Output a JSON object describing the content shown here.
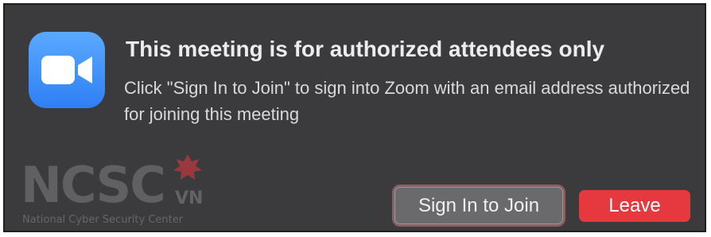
{
  "dialog": {
    "app_icon": "zoom-video-camera-icon",
    "title": "This meeting is for authorized attendees only",
    "message": "Click \"Sign In to Join\" to sign into Zoom with an email address authorized for joining this meeting"
  },
  "buttons": {
    "sign_in_label": "Sign In to Join",
    "leave_label": "Leave"
  },
  "watermark": {
    "logo": "NCSC",
    "suffix": "VN",
    "tagline": "National Cyber Security Center"
  },
  "colors": {
    "dialog_background": "#3b3b3d",
    "app_icon_blue": "#2f7ff5",
    "leave_red": "#e5393f",
    "sign_in_gray": "#6a6a6c"
  }
}
